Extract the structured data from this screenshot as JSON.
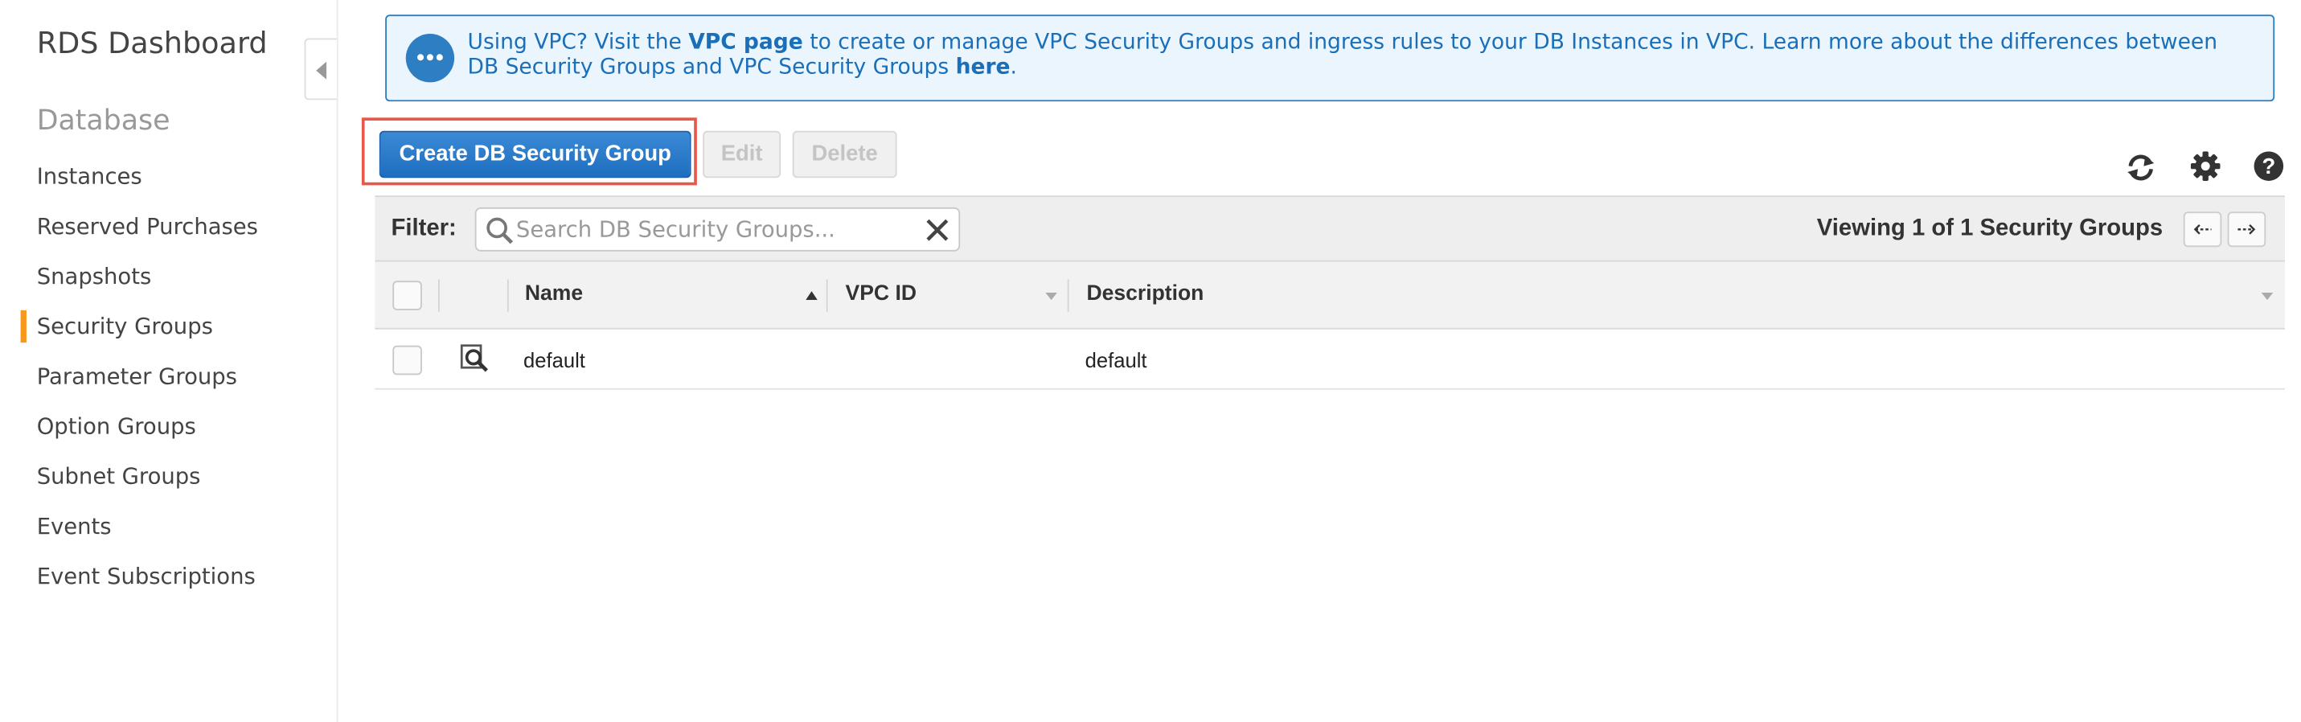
{
  "sidebar": {
    "title": "RDS Dashboard",
    "section": "Database",
    "items": [
      {
        "label": "Instances"
      },
      {
        "label": "Reserved Purchases"
      },
      {
        "label": "Snapshots"
      },
      {
        "label": "Security Groups",
        "active": true
      },
      {
        "label": "Parameter Groups"
      },
      {
        "label": "Option Groups"
      },
      {
        "label": "Subnet Groups"
      },
      {
        "label": "Events"
      },
      {
        "label": "Event Subscriptions"
      }
    ]
  },
  "banner": {
    "text_1": "Using VPC? Visit the ",
    "link_vpc_page": "VPC page",
    "text_2": " to create or manage VPC Security Groups and ingress rules to your DB Instances in VPC. Learn more about the differences between DB Security Groups and VPC Security Groups ",
    "link_here": "here",
    "text_3": "."
  },
  "toolbar": {
    "create_label": "Create DB Security Group",
    "edit_label": "Edit",
    "delete_label": "Delete",
    "icons": [
      "refresh-icon",
      "gear-icon",
      "help-icon"
    ]
  },
  "filter": {
    "label": "Filter:",
    "placeholder": "Search DB Security Groups...",
    "viewing": "Viewing 1 of 1 Security Groups"
  },
  "table": {
    "columns": [
      "Name",
      "VPC ID",
      "Description"
    ],
    "rows": [
      {
        "name": "default",
        "vpc_id": "",
        "description": "default"
      }
    ]
  },
  "colors": {
    "accent": "#1e6ebf",
    "active_marker": "#f7981d",
    "highlight_border": "#e8584a",
    "banner_bg": "#eaf5fd"
  }
}
